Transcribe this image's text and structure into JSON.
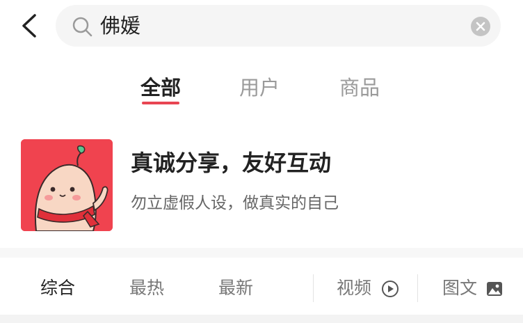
{
  "search": {
    "query": "佛媛",
    "back_icon": "chevron-left-icon",
    "search_icon": "magnifier-icon",
    "clear_icon": "clear-circle-icon"
  },
  "tabs": [
    {
      "label": "全部",
      "active": true
    },
    {
      "label": "用户",
      "active": false
    },
    {
      "label": "商品",
      "active": false
    }
  ],
  "notice_card": {
    "title": "真诚分享，友好互动",
    "subtitle": "勿立虚假人设，做真实的自己",
    "avatar_icon": "mascot-potato-avatar"
  },
  "filters": {
    "comprehensive": "综合",
    "hottest": "最热",
    "newest": "最新",
    "video": "视频",
    "image_text": "图文",
    "video_icon": "play-circle-icon",
    "image_icon": "image-icon"
  },
  "colors": {
    "accent": "#e84552",
    "avatar_bg": "#f0434f",
    "search_bg": "#f5f5f5"
  }
}
